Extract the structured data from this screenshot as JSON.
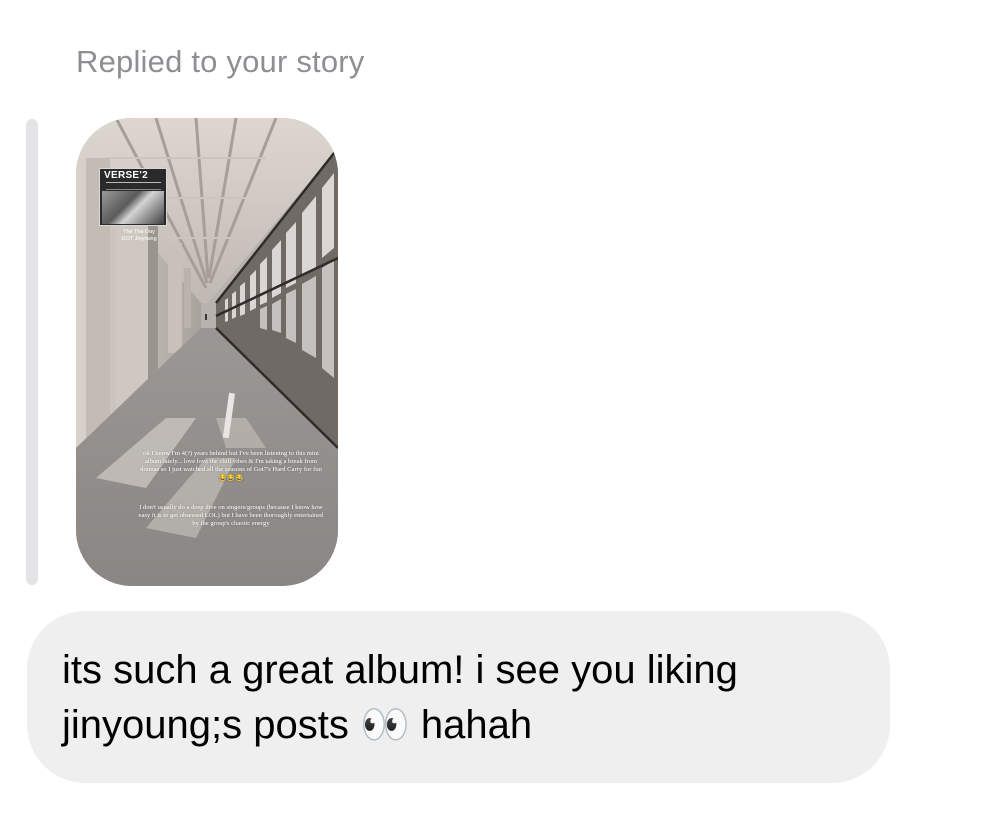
{
  "reply_header": {
    "label": "Replied to your story"
  },
  "story": {
    "album_title": "VERSE'2",
    "song_line1": "Thé The Day",
    "song_line2": "GOT Jinyoung",
    "paragraph1": "ok I know I'm 4(?) years behind but I've been listening to this mini album lately... love love the chill vibes & I'm taking a break from dramas so I just watched all the seasons of Got7's Hard Carry for fun 😂😂😂",
    "paragraph2": "I don't usually do a deep dive on singers/groups (because I know how easy it is to get obsessed LOL) but I have been thoroughly entertained by the group's chaotic energy"
  },
  "message": {
    "line1": "its such a great album! i see you liking",
    "line2": "jinyoung;s posts 👀 hahah"
  },
  "colors": {
    "background": "#ffffff",
    "label_gray": "#8e8e93",
    "bubble_bg": "#efeff0",
    "quote_bar": "#e4e4e6",
    "text": "#000000"
  }
}
